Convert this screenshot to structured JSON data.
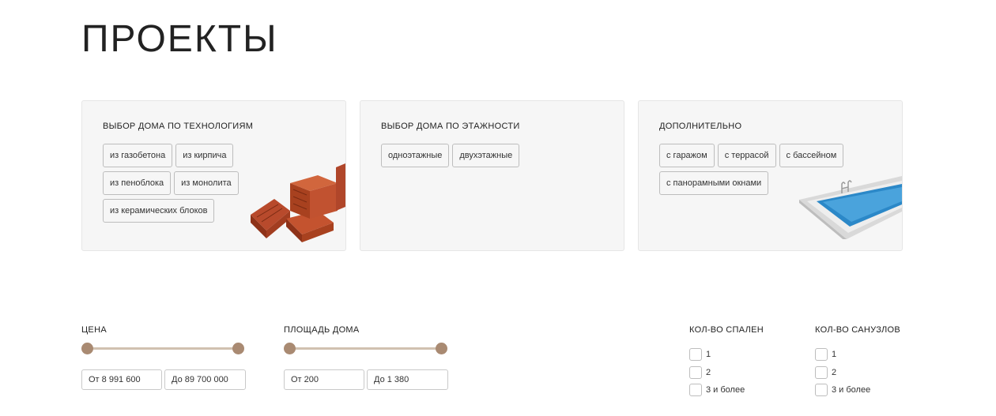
{
  "page": {
    "title": "ПРОЕКТЫ"
  },
  "cards": [
    {
      "title": "ВЫБОР ДОМА ПО ТЕХНОЛОГИЯМ",
      "chips": [
        "из газобетона",
        "из кирпича",
        "из пеноблока",
        "из монолита",
        "из керамических блоков"
      ]
    },
    {
      "title": "ВЫБОР ДОМА ПО ЭТАЖНОСТИ",
      "chips": [
        "одноэтажные",
        "двухэтажные"
      ]
    },
    {
      "title": "ДОПОЛНИТЕЛЬНО",
      "chips": [
        "с гаражом",
        "с террасой",
        "с бассейном",
        "с панорамными окнами"
      ]
    }
  ],
  "filters": {
    "price": {
      "label": "ЦЕНА",
      "from": "От 8 991 600",
      "to": "До 89 700 000"
    },
    "area": {
      "label": "ПЛОЩАДЬ ДОМА",
      "from": "От 200",
      "to": "До 1 380"
    },
    "bedrooms": {
      "label": "КОЛ-ВО СПАЛЕН",
      "options": [
        "1",
        "2",
        "3 и более"
      ]
    },
    "bathrooms": {
      "label": "КОЛ-ВО САНУЗЛОВ",
      "options": [
        "1",
        "2",
        "3 и более"
      ]
    }
  },
  "colors": {
    "accent": "#a98a72",
    "track": "#d1c1b0",
    "card_bg": "#f6f6f6"
  }
}
